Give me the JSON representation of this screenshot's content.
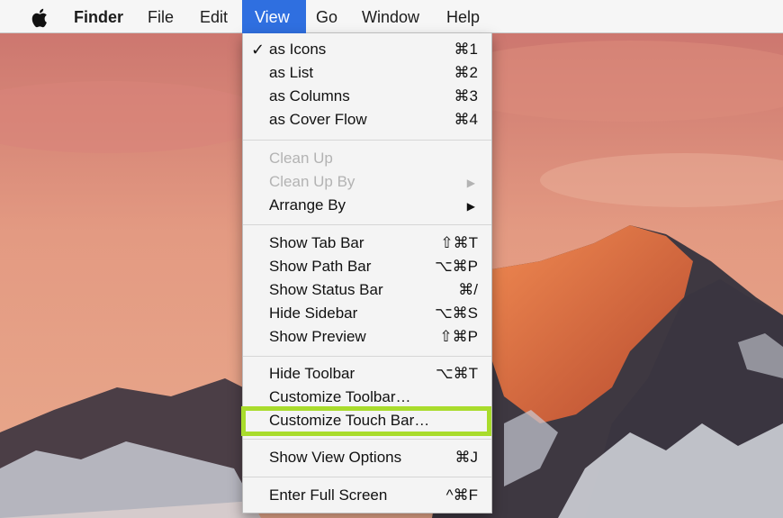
{
  "menubar": {
    "apple_icon": "apple-logo-icon",
    "items": [
      {
        "label": "Finder"
      },
      {
        "label": "File"
      },
      {
        "label": "Edit"
      },
      {
        "label": "View"
      },
      {
        "label": "Go"
      },
      {
        "label": "Window"
      },
      {
        "label": "Help"
      }
    ],
    "active_item": "View",
    "active_color": "#2f6fe0"
  },
  "view_menu": {
    "group1": [
      {
        "label": "as Icons",
        "shortcut": "⌘1",
        "checked": true,
        "check_glyph": "✓"
      },
      {
        "label": "as List",
        "shortcut": "⌘2"
      },
      {
        "label": "as Columns",
        "shortcut": "⌘3"
      },
      {
        "label": "as Cover Flow",
        "shortcut": "⌘4"
      }
    ],
    "group2": [
      {
        "label": "Clean Up",
        "enabled": false
      },
      {
        "label": "Clean Up By",
        "enabled": false,
        "submenu_glyph": "▶"
      },
      {
        "label": "Arrange By",
        "enabled": true,
        "submenu_glyph": "▶"
      }
    ],
    "group3": [
      {
        "label": "Show Tab Bar",
        "shortcut": "⇧⌘T"
      },
      {
        "label": "Show Path Bar",
        "shortcut": "⌥⌘P"
      },
      {
        "label": "Show Status Bar",
        "shortcut": "⌘/"
      },
      {
        "label": "Hide Sidebar",
        "shortcut": "⌥⌘S"
      },
      {
        "label": "Show Preview",
        "shortcut": "⇧⌘P"
      }
    ],
    "group4": [
      {
        "label": "Hide Toolbar",
        "shortcut": "⌥⌘T"
      },
      {
        "label": "Customize Toolbar…"
      },
      {
        "label": "Customize Touch Bar…",
        "highlighted": true,
        "highlight_color": "#a9dc2c"
      }
    ],
    "group5": [
      {
        "label": "Show View Options",
        "shortcut": "⌘J"
      }
    ],
    "group6": [
      {
        "label": "Enter Full Screen",
        "shortcut": "^⌘F"
      }
    ]
  }
}
